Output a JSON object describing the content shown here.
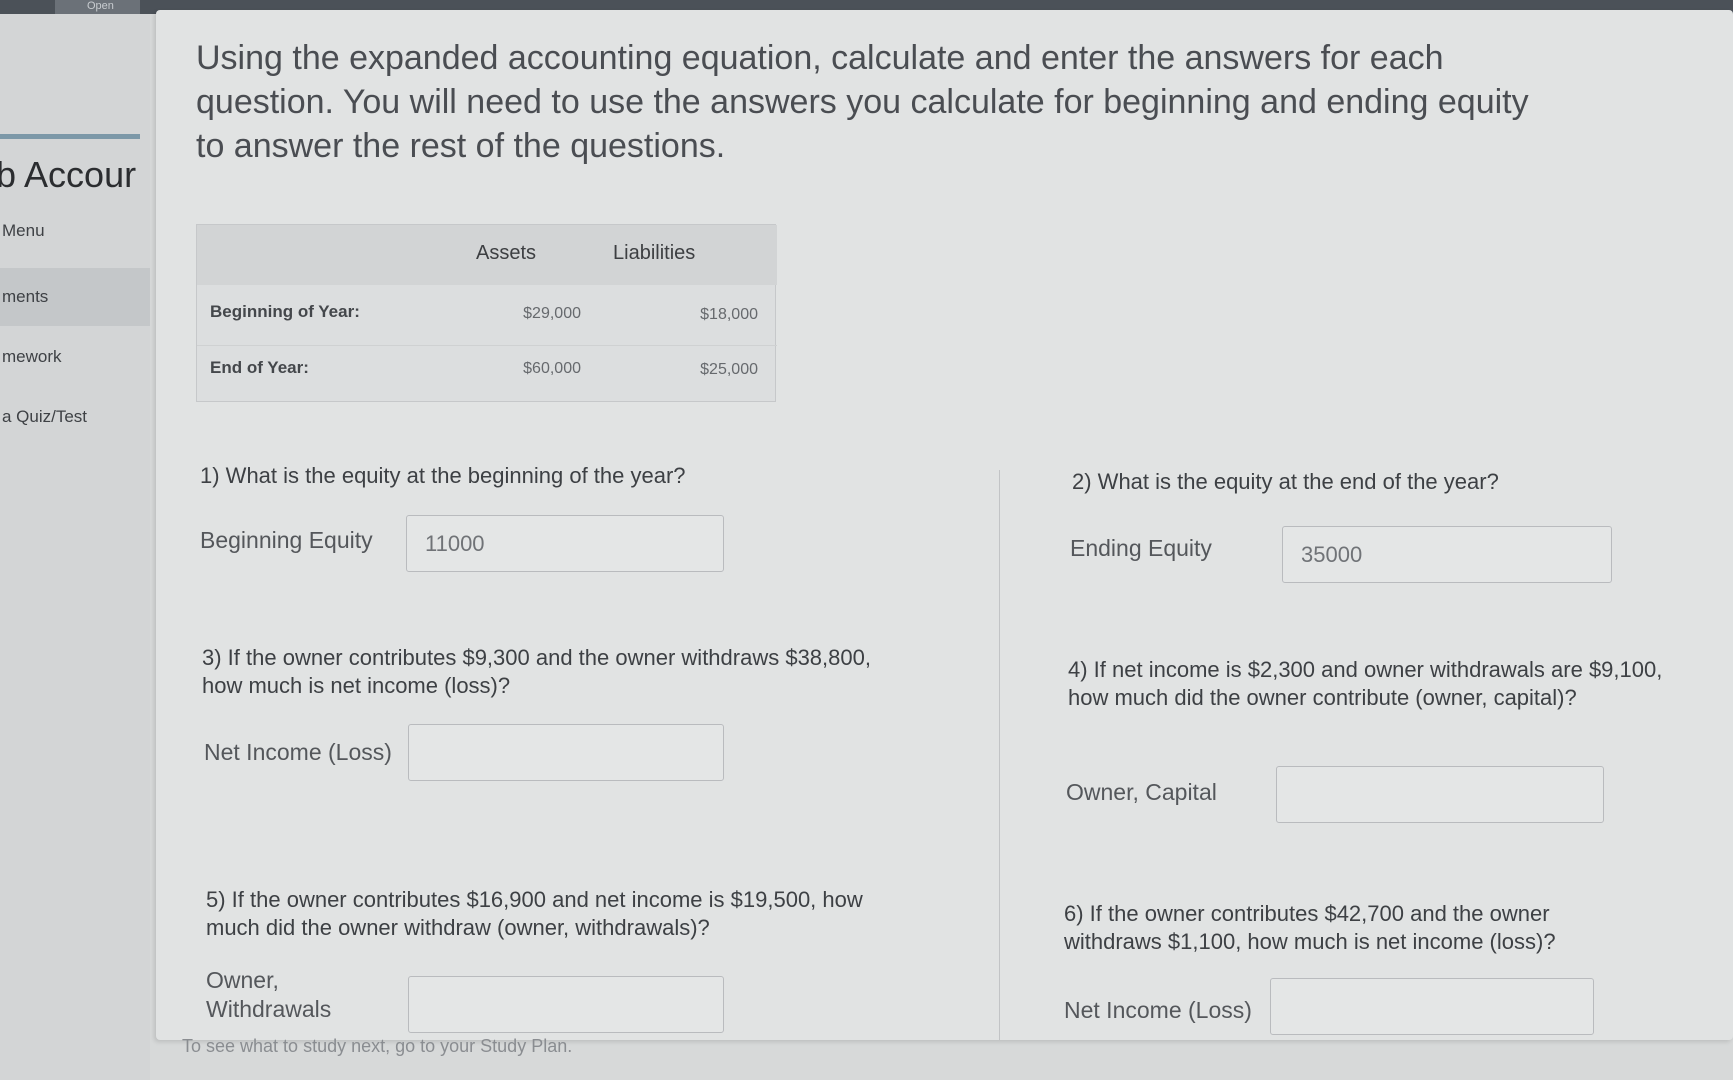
{
  "topbar": {
    "button_label": "Open"
  },
  "sidebar": {
    "title": "b Accour",
    "items": [
      {
        "label": "Menu"
      },
      {
        "label": "ments"
      },
      {
        "label": "mework"
      },
      {
        "label": "a Quiz/Test"
      }
    ]
  },
  "instructions": "Using the expanded accounting equation, calculate and enter the answers for each question. You will need to use the answers you calculate for beginning and ending equity to answer the rest of the questions.",
  "table": {
    "headers": {
      "assets": "Assets",
      "liabilities": "Liabilities"
    },
    "rows": [
      {
        "label": "Beginning of Year:",
        "assets": "$29,000",
        "liabilities": "$18,000"
      },
      {
        "label": "End of Year:",
        "assets": "$60,000",
        "liabilities": "$25,000"
      }
    ]
  },
  "questions": {
    "q1": {
      "text": "1) What is the equity at the beginning of the year?",
      "field_label": "Beginning Equity",
      "value": "11000"
    },
    "q2": {
      "text": "2) What is the equity at the end of the year?",
      "field_label": "Ending Equity",
      "value": "35000"
    },
    "q3": {
      "text": "3) If the owner contributes $9,300 and the owner withdraws $38,800, how much is net income (loss)?",
      "field_label": "Net Income (Loss)",
      "value": ""
    },
    "q4": {
      "text": "4) If net income is $2,300 and owner withdrawals are $9,100, how much did the owner contribute (owner, capital)?",
      "field_label": "Owner, Capital",
      "value": ""
    },
    "q5": {
      "text": "5) If the owner contributes $16,900 and net income is $19,500, how much did the owner withdraw (owner, withdrawals)?",
      "field_label": "Owner, Withdrawals",
      "value": ""
    },
    "q6": {
      "text": "6) If the owner contributes $42,700 and the owner withdraws $1,100, how much is net income (loss)?",
      "field_label": "Net Income (Loss)",
      "value": ""
    }
  },
  "footer": "To see what to study next, go to your Study Plan."
}
